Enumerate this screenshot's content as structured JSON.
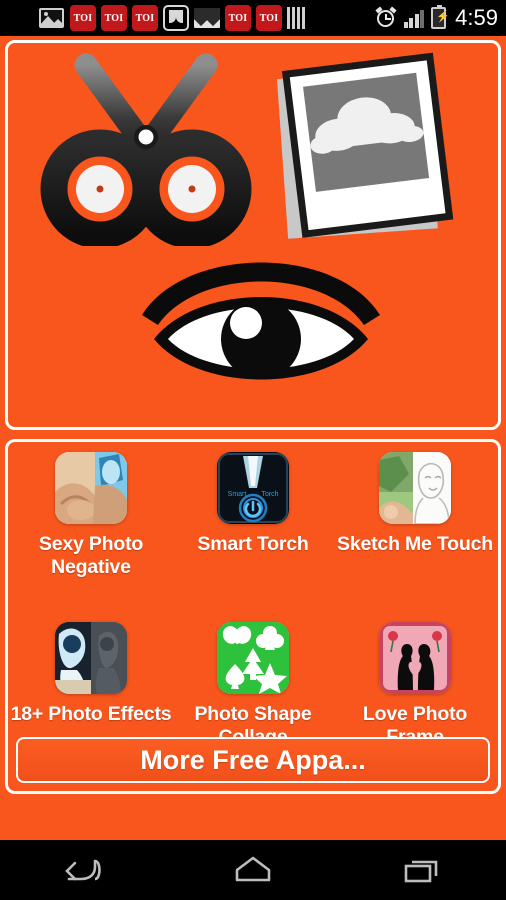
{
  "status_bar": {
    "icons": [
      {
        "name": "wifi-icon",
        "label": ""
      },
      {
        "name": "gallery-icon",
        "label": ""
      },
      {
        "name": "toi-notification-icon-1",
        "label": "TOI"
      },
      {
        "name": "toi-notification-icon-2",
        "label": "TOI"
      },
      {
        "name": "toi-notification-icon-3",
        "label": "TOI"
      },
      {
        "name": "flipkart-icon",
        "label": ""
      },
      {
        "name": "gmail-icon",
        "label": ""
      },
      {
        "name": "toi-notification-icon-4",
        "label": "TOI"
      },
      {
        "name": "toi-notification-icon-5",
        "label": "TOI"
      },
      {
        "name": "bars-icon",
        "label": ""
      }
    ],
    "toi_label": "TOI",
    "alarm_icon": "alarm-clock-icon",
    "signal_icon": "cellular-signal-icon",
    "battery_icon": "battery-charging-icon",
    "time": "4:59"
  },
  "hero": {
    "scissors_icon": "scissors-icon",
    "polaroid_icon": "polaroid-photo-icon",
    "eye_icon": "eye-icon"
  },
  "apps": [
    {
      "name": "sexy-photo-negative",
      "label": "Sexy Photo\nNegative",
      "tile": "photo-negative-thumbnail"
    },
    {
      "name": "smart-torch",
      "label": "Smart Torch",
      "tile": "smart-torch-thumbnail",
      "tile_text_left": "Smart",
      "tile_text_right": "Torch"
    },
    {
      "name": "sketch-me-touch",
      "label": "Sketch Me Touch",
      "tile": "sketch-me-thumbnail"
    },
    {
      "name": "18-plus-photo-effects",
      "label": "18+ Photo Effects",
      "tile": "photo-effects-thumbnail"
    },
    {
      "name": "photo-shape-collage",
      "label": "Photo Shape\nCollage",
      "tile": "photo-shape-thumbnail"
    },
    {
      "name": "love-photo-frame",
      "label": "Love Photo Frame",
      "tile": "love-frame-thumbnail"
    }
  ],
  "more_button": {
    "label": "More Free Appa..."
  },
  "nav_bar": {
    "back": "back-nav-button",
    "home": "home-nav-button",
    "recents": "recents-nav-button"
  },
  "colors": {
    "background_orange": "#F8561C",
    "panel_border": "#FFFFFF",
    "status_bar": "#000000",
    "toi_red": "#C1191B",
    "caption_white": "#FFFFFF"
  }
}
